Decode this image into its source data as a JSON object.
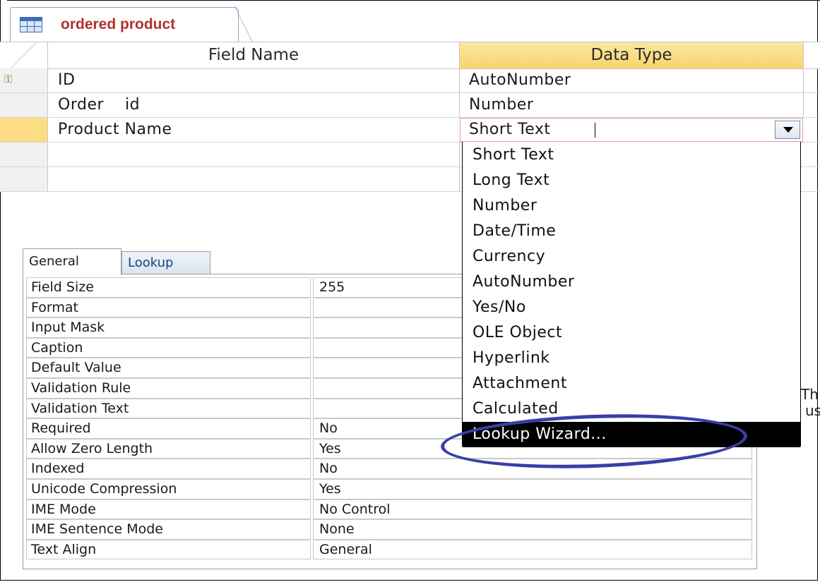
{
  "document_tab": {
    "label": "ordered product",
    "icon": "table-icon"
  },
  "grid": {
    "header": {
      "field_name": "Field Name",
      "data_type": "Data Type"
    },
    "rows": [
      {
        "field": "ID",
        "type": "AutoNumber",
        "primary_key": true
      },
      {
        "field": "Order    id",
        "type": "Number"
      },
      {
        "field": "Product Name",
        "type": "Short Text",
        "current": true
      }
    ]
  },
  "dropdown": {
    "options": [
      "Short Text",
      "Long Text",
      "Number",
      "Date/Time",
      "Currency",
      "AutoNumber",
      "Yes/No",
      "OLE Object",
      "Hyperlink",
      "Attachment",
      "Calculated",
      "Lookup Wizard..."
    ],
    "highlighted": "Lookup Wizard..."
  },
  "properties": {
    "tabs": [
      "General",
      "Lookup"
    ],
    "active_tab": "General",
    "rows": [
      {
        "label": "Field Size",
        "value": "255"
      },
      {
        "label": "Format",
        "value": ""
      },
      {
        "label": "Input Mask",
        "value": ""
      },
      {
        "label": "Caption",
        "value": ""
      },
      {
        "label": "Default Value",
        "value": ""
      },
      {
        "label": "Validation Rule",
        "value": ""
      },
      {
        "label": "Validation Text",
        "value": ""
      },
      {
        "label": "Required",
        "value": "No"
      },
      {
        "label": "Allow Zero Length",
        "value": "Yes"
      },
      {
        "label": "Indexed",
        "value": "No"
      },
      {
        "label": "Unicode Compression",
        "value": "Yes"
      },
      {
        "label": "IME Mode",
        "value": "No Control"
      },
      {
        "label": "IME Sentence Mode",
        "value": "None"
      },
      {
        "label": "Text Align",
        "value": "General"
      }
    ]
  },
  "clipped_help_text": [
    "Th",
    "us"
  ],
  "colors": {
    "highlight_bg": "#000000",
    "header_type_bg": "#f8d46b",
    "current_row": "#fcdd83",
    "annotation_circle": "#3a3ea8",
    "tab_label": "#b2312b"
  }
}
